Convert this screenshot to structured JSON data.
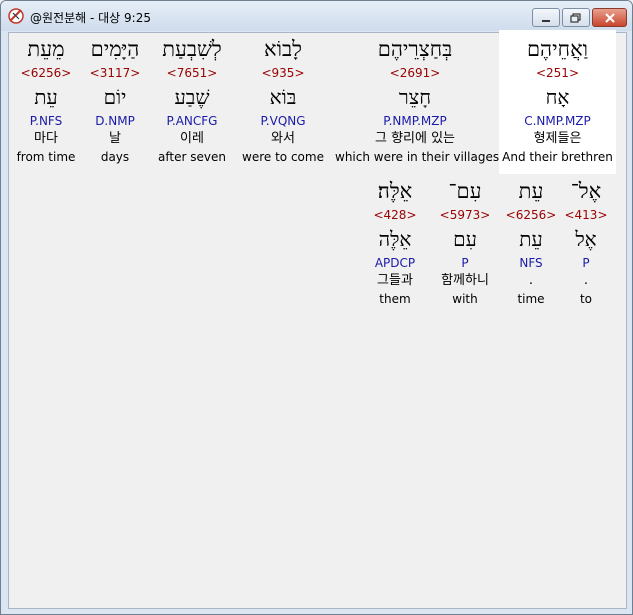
{
  "window": {
    "title": "@원전분해 - 대상 9:25"
  },
  "row1": [
    {
      "heb": "מֵעֵת",
      "strong": "<6256>",
      "root": "עֵת",
      "parse": "P.NFS",
      "kor": "마다",
      "eng": "from time"
    },
    {
      "heb": "הַיָּמִים",
      "strong": "<3117>",
      "root": "יוֹם",
      "parse": "D.NMP",
      "kor": "날",
      "eng": "days"
    },
    {
      "heb": "לְשִׁבְעַת",
      "strong": "<7651>",
      "root": "שֶׁבַע",
      "parse": "P.ANCFG",
      "kor": "이레",
      "eng": "after seven"
    },
    {
      "heb": "לָבוֹא",
      "strong": "<935>",
      "root": "בּוֹא",
      "parse": "P.VQNG",
      "kor": "와서",
      "eng": "were to come"
    },
    {
      "heb": "בְּחַצְרֵיהֶם",
      "strong": "<2691>",
      "root": "חָצֵר",
      "parse": "P.NMP.MZP",
      "kor": "그 향리에 있는",
      "eng": "which were in their villages"
    },
    {
      "heb": "וַאֲחֵיהֶם",
      "strong": "<251>",
      "root": "אָח",
      "parse": "C.NMP.MZP",
      "kor": "형제들은",
      "eng": "And their brethren"
    }
  ],
  "row2": [
    {
      "heb": "אֵלֶּה׃",
      "strong": "<428>",
      "root": "אֵלֶּה",
      "parse": "APDCP",
      "kor": "그들과",
      "eng": "them"
    },
    {
      "heb": "עִם־",
      "strong": "<5973>",
      "root": "עִם",
      "parse": "P",
      "kor": "함께하니",
      "eng": "with"
    },
    {
      "heb": "עֵת",
      "strong": "<6256>",
      "root": "עֵת",
      "parse": "NFS",
      "kor": ".",
      "eng": "time"
    },
    {
      "heb": "אֶל־",
      "strong": "<413>",
      "root": "אֶל",
      "parse": "P",
      "kor": ".",
      "eng": "to"
    }
  ]
}
